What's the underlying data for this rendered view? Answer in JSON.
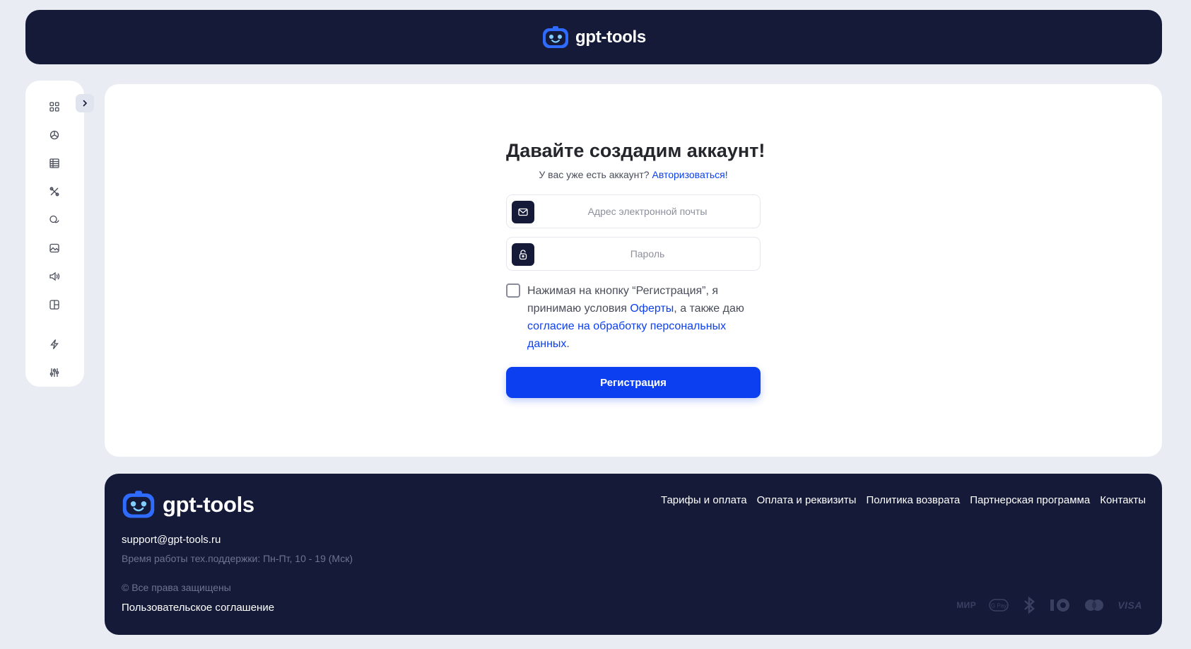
{
  "brand": {
    "name": "gpt-tools"
  },
  "colors": {
    "dark": "#141a38",
    "accent": "#0b3ff0",
    "background": "#e9ecf3"
  },
  "sidebar": {
    "items": [
      {
        "icon": "grid-icon"
      },
      {
        "icon": "openai-icon"
      },
      {
        "icon": "document-icon"
      },
      {
        "icon": "tools-icon"
      },
      {
        "icon": "chat-icon"
      },
      {
        "icon": "image-icon"
      },
      {
        "icon": "audio-icon"
      },
      {
        "icon": "layout-icon"
      },
      {
        "icon": "lightning-icon"
      },
      {
        "icon": "settings-sliders-icon"
      }
    ],
    "expand_icon": "chevron-right-icon"
  },
  "form": {
    "title": "Давайте создадим аккаунт!",
    "subtitle_text": "У вас уже есть аккаунт?",
    "subtitle_link": "Авторизоваться!",
    "email_placeholder": "Адрес электронной почты",
    "password_placeholder": "Пароль",
    "agree_part1": "Нажимая на кнопку “Регистрация”, я принимаю условия ",
    "agree_link1": "Оферты",
    "agree_part2": ", а также даю ",
    "agree_link2": "согласие на обработку персональных данных",
    "agree_part3": ".",
    "submit_label": "Регистрация"
  },
  "footer": {
    "nav": [
      "Тарифы и оплата",
      "Оплата и реквизиты",
      "Политика возврата",
      "Партнерская программа",
      "Контакты"
    ],
    "email": "support@gpt-tools.ru",
    "hours": "Время работы тех.поддержки: Пн-Пт, 10 - 19 (Мск)",
    "rights": "© Все права защищены",
    "terms": "Пользовательское соглашение",
    "payments": [
      "МИР",
      "G Pay",
      "bluetooth",
      "ЮMoney",
      "Mastercard",
      "VISA"
    ]
  }
}
